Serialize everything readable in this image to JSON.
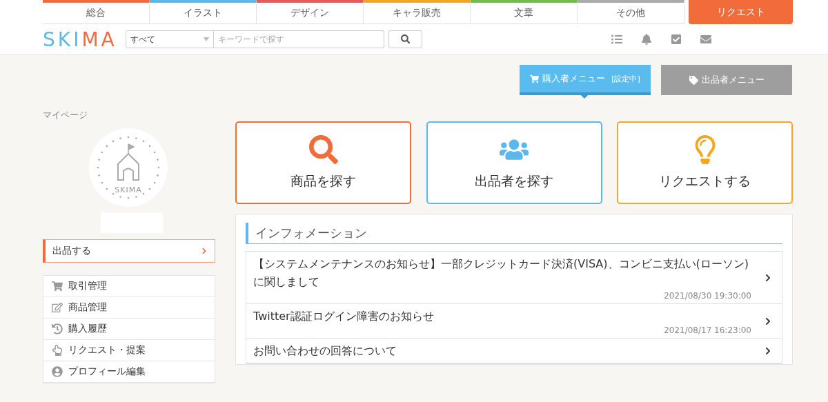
{
  "categories": [
    {
      "label": "総合",
      "color": "#f26b3a"
    },
    {
      "label": "イラスト",
      "color": "#5bb8ec"
    },
    {
      "label": "デザイン",
      "color": "#e65a5a"
    },
    {
      "label": "キャラ販売",
      "color": "#f5a623"
    },
    {
      "label": "文章",
      "color": "#6cc04a"
    },
    {
      "label": "その他",
      "color": "#aaaaaa"
    }
  ],
  "request_button": "リクエスト",
  "logo": [
    {
      "text": "SKI",
      "color": "#5bb8ec"
    },
    {
      "text": "MA",
      "color": "#f26b3a"
    }
  ],
  "search": {
    "scope": "すべて",
    "placeholder": "キーワードで探す"
  },
  "mode_buttons": [
    {
      "kind": "buyer",
      "label": "購入者メニュー",
      "badge": "[設定中]",
      "selected": true
    },
    {
      "kind": "seller",
      "label": "出品者メニュー",
      "selected": false
    }
  ],
  "breadcrumb": "マイページ",
  "avatar_text": "SKIMA",
  "sell_button": "出品する",
  "sidebar": {
    "items": [
      {
        "kind": "cart",
        "label": "取引管理"
      },
      {
        "kind": "edit",
        "label": "商品管理"
      },
      {
        "kind": "history",
        "label": "購入履歴"
      },
      {
        "kind": "hand",
        "label": "リクエスト・提案"
      },
      {
        "kind": "user",
        "label": "プロフィール編集"
      }
    ]
  },
  "action_cards": [
    {
      "kind": "search",
      "label": "商品を探す",
      "color": "#f26b3a"
    },
    {
      "kind": "people",
      "label": "出品者を探す",
      "color": "#5bb8ec"
    },
    {
      "kind": "bulb",
      "label": "リクエストする",
      "color": "#f5a623"
    }
  ],
  "information": {
    "title": "インフォメーション",
    "items": [
      {
        "title": "【システムメンテナンスのお知らせ】一部クレジットカード決済(VISA)、コンビニ支払い(ローソン)に関しまして",
        "date": "2021/08/30 19:30:00"
      },
      {
        "title": "Twitter認証ログイン障害のお知らせ",
        "date": "2021/08/17 16:23:00"
      },
      {
        "title": "お問い合わせの回答について"
      }
    ]
  }
}
